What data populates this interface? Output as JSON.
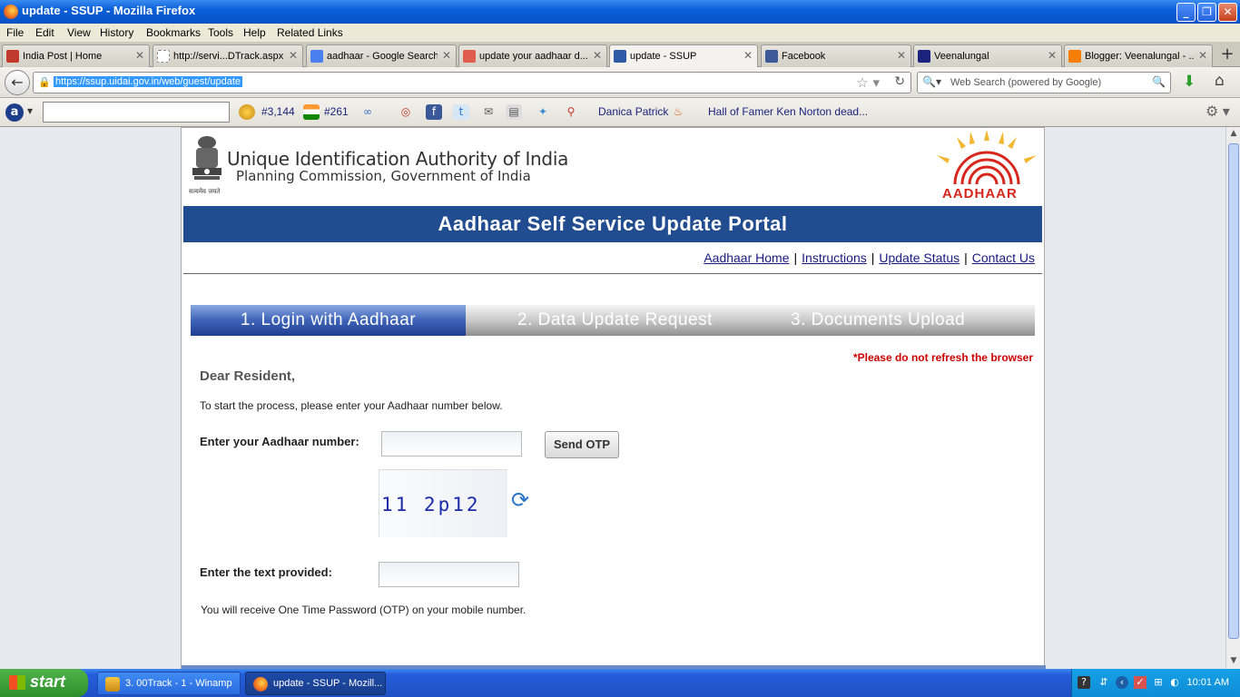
{
  "window": {
    "title": "update - SSUP - Mozilla Firefox",
    "minimize": "_",
    "restore": "❐",
    "close": "✕"
  },
  "menu": [
    "File",
    "Edit",
    "View",
    "History",
    "Bookmarks",
    "Tools",
    "Help",
    "Related Links"
  ],
  "tabs": [
    {
      "label": "India Post | Home",
      "icon_color": "#c0392b"
    },
    {
      "label": "http://servi...DTrack.aspx",
      "icon_color": "#ffffff"
    },
    {
      "label": "aadhaar - Google Search",
      "icon_color": "#4a7ff0"
    },
    {
      "label": "update your aadhaar d...",
      "icon_color": "#e05d4e"
    },
    {
      "label": "update - SSUP",
      "icon_color": "#2e5aa8"
    },
    {
      "label": "Facebook",
      "icon_color": "#3b5998"
    },
    {
      "label": "Veenalungal",
      "icon_color": "#1a237e"
    },
    {
      "label": "Blogger: Veenalungal - ...",
      "icon_color": "#f57d00"
    }
  ],
  "tab_close": "✕",
  "new_tab": "+",
  "navbar": {
    "back": "←",
    "lock": "🔒",
    "url": "https://ssup.uidai.gov.in/web/guest/update",
    "star": "☆ ▾",
    "reload": "↻",
    "search_placeholder": "Web Search (powered by Google)",
    "search_icon": "🔍▾",
    "go": "🔍",
    "download": "⬇",
    "home": "⌂"
  },
  "toolbar2": {
    "a_logo": "a",
    "a_menu": "▾",
    "rank1": "#3,144",
    "rank2": "#261",
    "item1": "Danica Patrick",
    "item2": "Hall of Famer Ken Norton dead...",
    "gear": "⚙ ▾"
  },
  "page": {
    "org_title": "Unique Identification Authority of India",
    "org_sub": "Planning Commission, Government of India",
    "emblem_text": "सत्यमेव जयते",
    "logo_text": "AADHAAR",
    "banner": "Aadhaar Self Service Update Portal",
    "links": [
      "Aadhaar Home",
      "Instructions",
      "Update Status",
      "Contact Us"
    ],
    "link_sep": "|",
    "steps": [
      "1. Login with Aadhaar",
      "2. Data Update Request",
      "3. Documents Upload"
    ],
    "warning": "*Please do not refresh the browser",
    "greeting": "Dear Resident,",
    "intro": "To start the process, please enter your Aadhaar number below.",
    "aadhaar_label": "Enter your Aadhaar number:",
    "aadhaar_value": "",
    "send_otp": "Send OTP",
    "captcha_text": "11 2p12",
    "refresh_icon": "⟳",
    "text_label": "Enter the text provided:",
    "text_value": "",
    "otp_note": "You will receive One Time Password (OTP) on your mobile number."
  },
  "taskbar": {
    "start": "start",
    "tasks": [
      "3. 00Track - 1 - Winamp",
      "update - SSUP - Mozill..."
    ],
    "clock": "10:01 AM",
    "tray_icons": [
      "?",
      "⇵",
      "‹",
      "✓",
      "⊞",
      "◐"
    ]
  },
  "colors": {
    "banner": "#214c90",
    "warning": "#cc0000",
    "logo_red": "#d7261c",
    "logo_yellow": "#f2b632",
    "taskbar": "#245edb"
  }
}
